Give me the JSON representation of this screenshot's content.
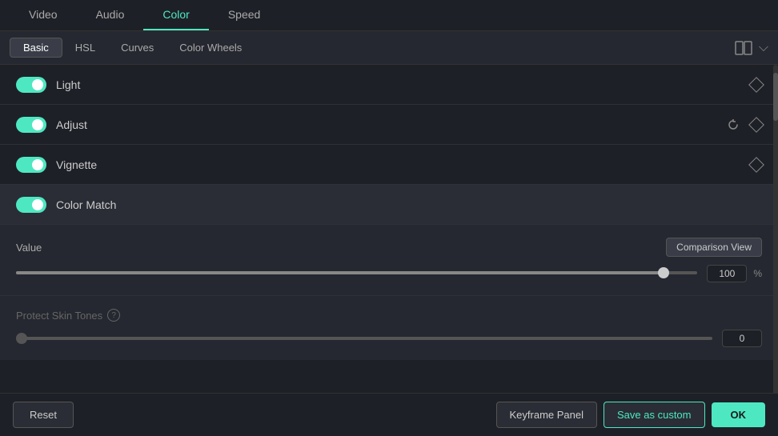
{
  "top_tabs": {
    "items": [
      {
        "id": "video",
        "label": "Video",
        "active": false
      },
      {
        "id": "audio",
        "label": "Audio",
        "active": false
      },
      {
        "id": "color",
        "label": "Color",
        "active": true
      },
      {
        "id": "speed",
        "label": "Speed",
        "active": false
      }
    ]
  },
  "sub_tabs": {
    "items": [
      {
        "id": "basic",
        "label": "Basic",
        "active": true
      },
      {
        "id": "hsl",
        "label": "HSL",
        "active": false
      },
      {
        "id": "curves",
        "label": "Curves",
        "active": false
      },
      {
        "id": "color_wheels",
        "label": "Color Wheels",
        "active": false
      }
    ]
  },
  "sections": [
    {
      "id": "light",
      "label": "Light",
      "enabled": true
    },
    {
      "id": "adjust",
      "label": "Adjust",
      "enabled": true,
      "has_reset": true
    },
    {
      "id": "vignette",
      "label": "Vignette",
      "enabled": true
    },
    {
      "id": "color_match",
      "label": "Color Match",
      "enabled": true
    }
  ],
  "value_slider": {
    "label": "Value",
    "value": "100",
    "unit": "%",
    "fill_percent": 95,
    "comparison_btn": "Comparison View"
  },
  "protect_slider": {
    "label": "Protect Skin Tones",
    "help": "?",
    "value": "0"
  },
  "bottom_bar": {
    "reset_label": "Reset",
    "keyframe_label": "Keyframe Panel",
    "save_custom_label": "Save as custom",
    "ok_label": "OK"
  }
}
